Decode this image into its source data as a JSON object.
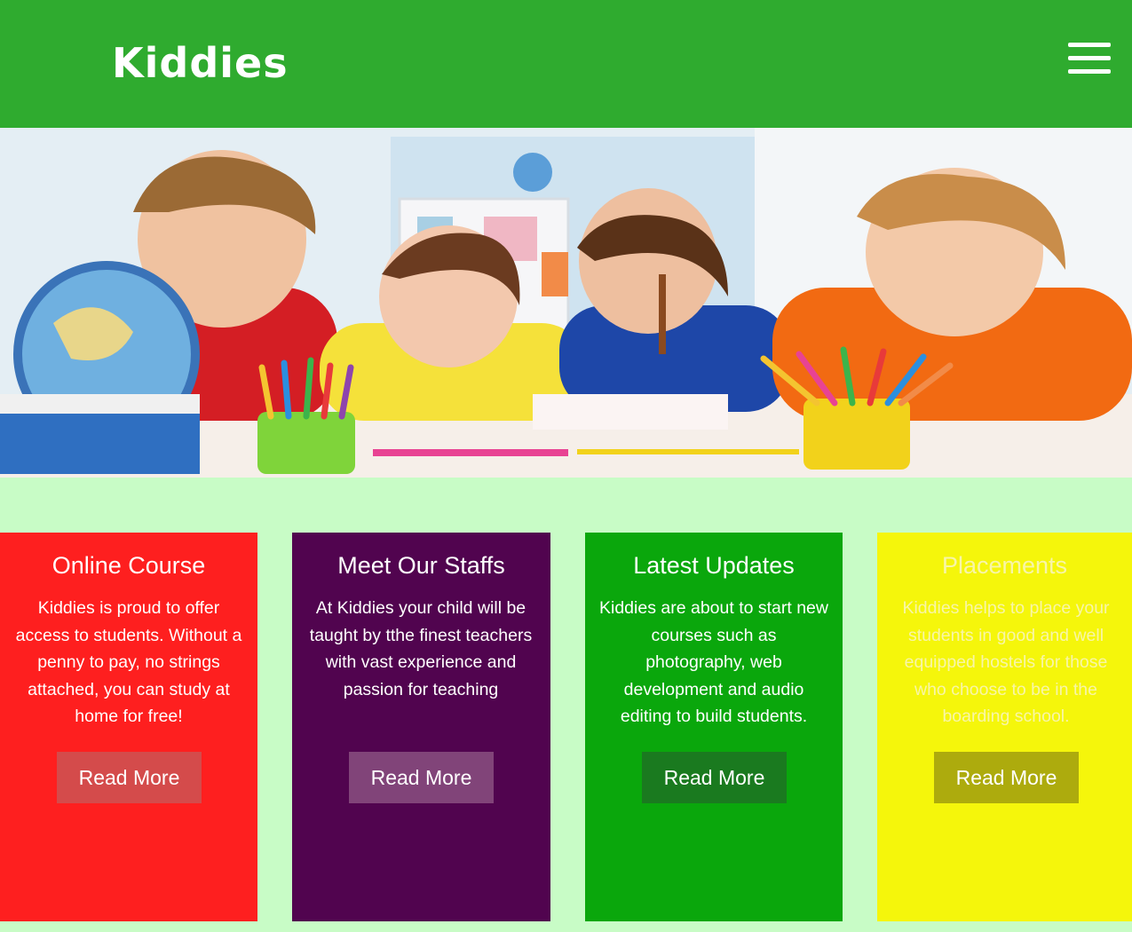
{
  "header": {
    "brand": "Kiddies",
    "menu_icon": "hamburger-menu-icon",
    "background_color": "#2fab2f"
  },
  "hero": {
    "image": "children-classroom-photo"
  },
  "cards": [
    {
      "title": "Online Course",
      "text": "Kiddies is proud to offer access to students. Without a penny to pay, no strings attached, you can study at home for free!",
      "button": "Read More",
      "color": "#fe1f1f"
    },
    {
      "title": "Meet Our Staffs",
      "text": "At Kiddies your child will be taught by tthe finest teachers with vast experience and passion for teaching",
      "button": "Read More",
      "color": "#51044f"
    },
    {
      "title": "Latest Updates",
      "text": "Kiddies are about to start new courses such as photography, web development and audio editing to build students.",
      "button": "Read More",
      "color": "#0aa70c"
    },
    {
      "title": "Placements",
      "text": "Kiddies helps to place your students in good and well equipped hostels for those who choose to be in the boarding school.",
      "button": "Read More",
      "color": "#f5f60b"
    }
  ],
  "page_background": "#c8fcc6"
}
